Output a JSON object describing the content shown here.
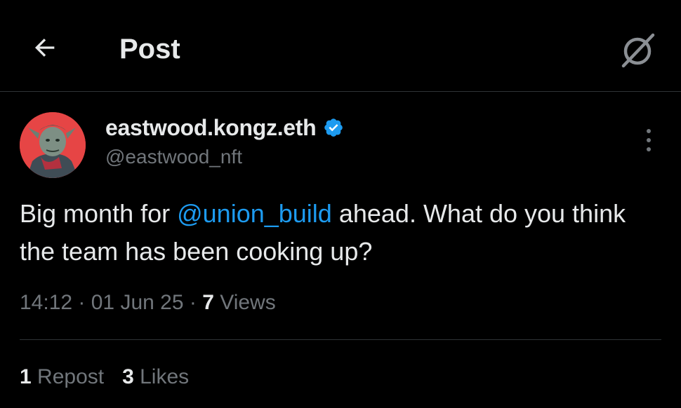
{
  "header": {
    "title": "Post",
    "back_icon": "arrow-left-icon",
    "grok_icon": "grok-icon"
  },
  "author": {
    "display_name": "eastwood.kongz.eth",
    "handle": "@eastwood_nft",
    "verified": true,
    "verified_color": "#1d9bf0"
  },
  "post": {
    "text_before": "Big month for ",
    "mention": "@union_build",
    "text_after": " ahead. What do you think the team has been cooking up?",
    "time": "14:12",
    "date": "01 Jun 25",
    "views_count": "7",
    "views_label": "Views"
  },
  "stats": {
    "reposts_count": "1",
    "reposts_label": "Repost",
    "likes_count": "3",
    "likes_label": "Likes"
  },
  "colors": {
    "background": "#000000",
    "text_primary": "#e7e9ea",
    "text_secondary": "#71767b",
    "accent": "#1d9bf0",
    "divider": "#2f3336"
  }
}
